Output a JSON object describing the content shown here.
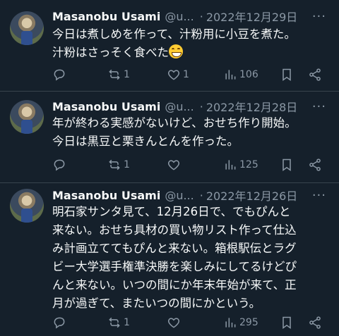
{
  "tweets": [
    {
      "name": "Masanobu Usami",
      "handle": "@u...",
      "dot": "·",
      "date": "2022年12月29日",
      "more": "···",
      "lines": [
        "今日は煮しめを作って、汁粉用に小豆を煮た。",
        "汁粉はさっそく食べた"
      ],
      "emoji": "grinning-face",
      "retweets": "1",
      "likes": "1",
      "views": "106"
    },
    {
      "name": "Masanobu Usami",
      "handle": "@u...",
      "dot": "·",
      "date": "2022年12月28日",
      "more": "···",
      "lines": [
        "年が終わる実感がないけど、おせち作り開始。",
        "今日は黒豆と栗きんとんを作った。"
      ],
      "retweets": "1",
      "likes": "",
      "views": "125"
    },
    {
      "name": "Masanobu Usami",
      "handle": "@u...",
      "dot": "·",
      "date": "2022年12月26日",
      "more": "···",
      "lines": [
        "明石家サンタ見て、12月26日で、でもぴんと",
        "来ない。おせち具材の買い物リスト作って仕込",
        "み計画立ててもぴんと来ない。箱根駅伝とラグ",
        "ビー大学選手権準決勝を楽しみにしてるけどぴ",
        "んと来ない。いつの間にか年末年始が来て、正",
        "月が過ぎて、またいつの間にかという。"
      ],
      "retweets": "1",
      "likes": "",
      "views": "295"
    }
  ],
  "icons": {
    "reply": "reply-icon",
    "retweet": "retweet-icon",
    "like": "heart-icon",
    "views": "views-icon",
    "bookmark": "bookmark-icon",
    "share": "share-icon"
  },
  "colors": {
    "background": "#15202b",
    "text": "#f7f9f9",
    "secondary": "#8b98a5",
    "divider": "#38444d"
  }
}
